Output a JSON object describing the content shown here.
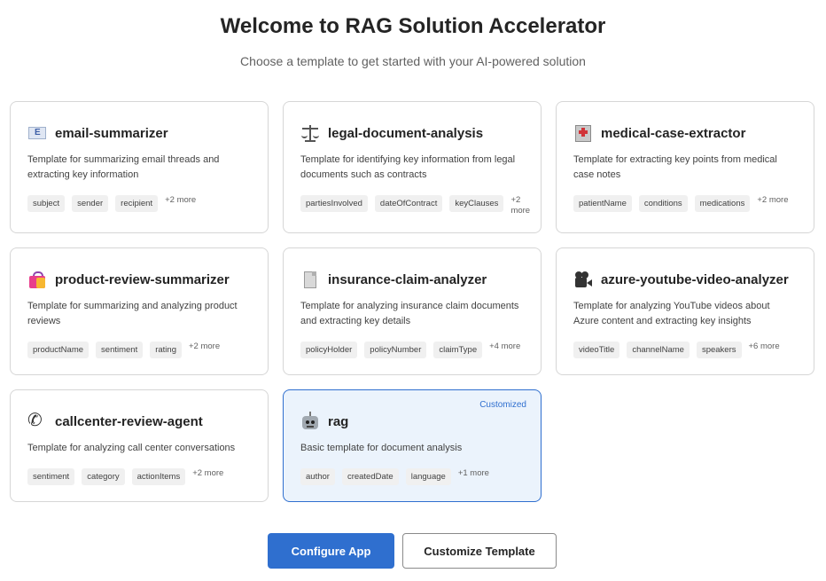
{
  "header": {
    "title": "Welcome to RAG Solution Accelerator",
    "subtitle": "Choose a template to get started with your AI-powered solution"
  },
  "templates": [
    {
      "icon": "envelope-icon",
      "title": "email-summarizer",
      "description": "Template for summarizing email threads and extracting key information",
      "tags": [
        "subject",
        "sender",
        "recipient"
      ],
      "more": "+2 more"
    },
    {
      "icon": "scales-icon",
      "title": "legal-document-analysis",
      "description": "Template for identifying key information from legal documents such as contracts",
      "tags": [
        "partiesInvolved",
        "dateOfContract",
        "keyClauses"
      ],
      "more": "+2 more"
    },
    {
      "icon": "hospital-icon",
      "title": "medical-case-extractor",
      "description": "Template for extracting key points from medical case notes",
      "tags": [
        "patientName",
        "conditions",
        "medications"
      ],
      "more": "+2 more"
    },
    {
      "icon": "shopping-bags-icon",
      "title": "product-review-summarizer",
      "description": "Template for summarizing and analyzing product reviews",
      "tags": [
        "productName",
        "sentiment",
        "rating"
      ],
      "more": "+2 more"
    },
    {
      "icon": "document-icon",
      "title": "insurance-claim-analyzer",
      "description": "Template for analyzing insurance claim documents and extracting key details",
      "tags": [
        "policyHolder",
        "policyNumber",
        "claimType"
      ],
      "more": "+4 more"
    },
    {
      "icon": "movie-camera-icon",
      "title": "azure-youtube-video-analyzer",
      "description": "Template for analyzing YouTube videos about Azure content and extracting key insights",
      "tags": [
        "videoTitle",
        "channelName",
        "speakers"
      ],
      "more": "+6 more"
    },
    {
      "icon": "telephone-icon",
      "title": "callcenter-review-agent",
      "description": "Template for analyzing call center conversations",
      "tags": [
        "sentiment",
        "category",
        "actionItems"
      ],
      "more": "+2 more"
    },
    {
      "icon": "robot-icon",
      "title": "rag",
      "description": "Basic template for document analysis",
      "tags": [
        "author",
        "createdDate",
        "language"
      ],
      "more": "+1 more",
      "badge": "Customized",
      "selected": true
    }
  ],
  "actions": {
    "configure_label": "Configure App",
    "customize_label": "Customize Template"
  },
  "colors": {
    "accent": "#2f6fcf",
    "selected_background": "#ebf3fc",
    "tag_background": "#f0f0f0"
  }
}
